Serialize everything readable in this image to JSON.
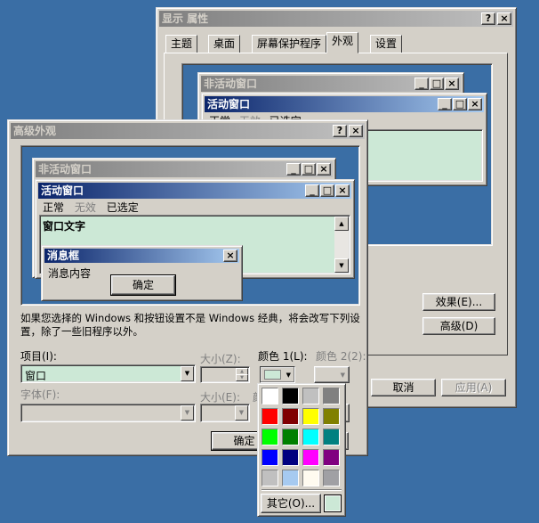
{
  "display_props": {
    "title": "显示 属性",
    "tabs": [
      "主题",
      "桌面",
      "屏幕保护程序",
      "外观",
      "设置"
    ],
    "preview": {
      "inactive_title": "非活动窗口",
      "active_title": "活动窗口",
      "menu": [
        "正常",
        "无效",
        "已选定"
      ]
    },
    "effects_button": "效果(E)...",
    "advanced_button": "高级(D)",
    "cancel_button": "取消",
    "apply_button": "应用(A)"
  },
  "advanced": {
    "title": "高级外观",
    "preview": {
      "inactive_title": "非活动窗口",
      "active_title": "活动窗口",
      "menu_normal": "正常",
      "menu_disabled": "无效",
      "menu_selected": "已选定",
      "window_text": "窗口文字",
      "msgbox_title": "消息框",
      "msgbox_text": "消息内容",
      "msgbox_ok": "确定"
    },
    "note": "如果您选择的 Windows 和按钮设置不是 Windows 经典，将会改写下列设置，除了一些旧程序以外。",
    "item_label": "项目(I):",
    "item_value": "窗口",
    "size_label": "大小(Z):",
    "color1_label": "颜色 1(L):",
    "color2_label": "颜色 2(2):",
    "font_label": "字体(F):",
    "font_size_label": "大小(E):",
    "font_color_label": "颜",
    "ok_button": "确定",
    "current_color1": "#cce8d6"
  },
  "color_picker": {
    "swatches": [
      "#ffffff",
      "#000000",
      "#c0c0c0",
      "#808080",
      "#ff0000",
      "#800000",
      "#ffff00",
      "#808000",
      "#00ff00",
      "#008000",
      "#00ffff",
      "#008080",
      "#0000ff",
      "#000080",
      "#ff00ff",
      "#800080",
      "#c0c0c0",
      "#a6caf0",
      "#fffbf0",
      "#a0a0a4"
    ],
    "other_button": "其它(O)...",
    "current": "#cce8d6"
  },
  "colors": {
    "desktop": "#3a6ea5",
    "window_bg": "#cce8d6",
    "face": "#d4d0c8"
  }
}
